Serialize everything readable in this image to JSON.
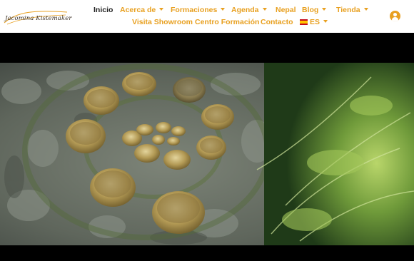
{
  "logo": {
    "text": "Jacomina Kistemaker",
    "accent_color": "#e8a020"
  },
  "nav": {
    "row1": [
      {
        "label": "Inicio",
        "active": true,
        "has_dropdown": false
      },
      {
        "label": "Acerca de",
        "active": false,
        "has_dropdown": true
      },
      {
        "label": "Formaciones",
        "active": false,
        "has_dropdown": true
      },
      {
        "label": "Agenda",
        "active": false,
        "has_dropdown": true
      },
      {
        "label": "Nepal",
        "active": false,
        "has_dropdown": false
      },
      {
        "label": "Blog",
        "active": false,
        "has_dropdown": true
      },
      {
        "label": "Tienda",
        "active": false,
        "has_dropdown": true
      }
    ],
    "row2": [
      {
        "label": "Visita Showroom",
        "has_dropdown": false
      },
      {
        "label": "Centro Formación",
        "has_dropdown": false
      },
      {
        "label": "Contacto",
        "has_dropdown": false
      },
      {
        "label": "ES",
        "has_dropdown": true,
        "flag": "spain-flag-icon"
      }
    ],
    "link_color": "#e8a020",
    "active_color": "#222222"
  },
  "account": {
    "icon": "user-icon"
  },
  "hero": {
    "image": "singing-bowls-spiral-on-stone-with-ferns"
  }
}
